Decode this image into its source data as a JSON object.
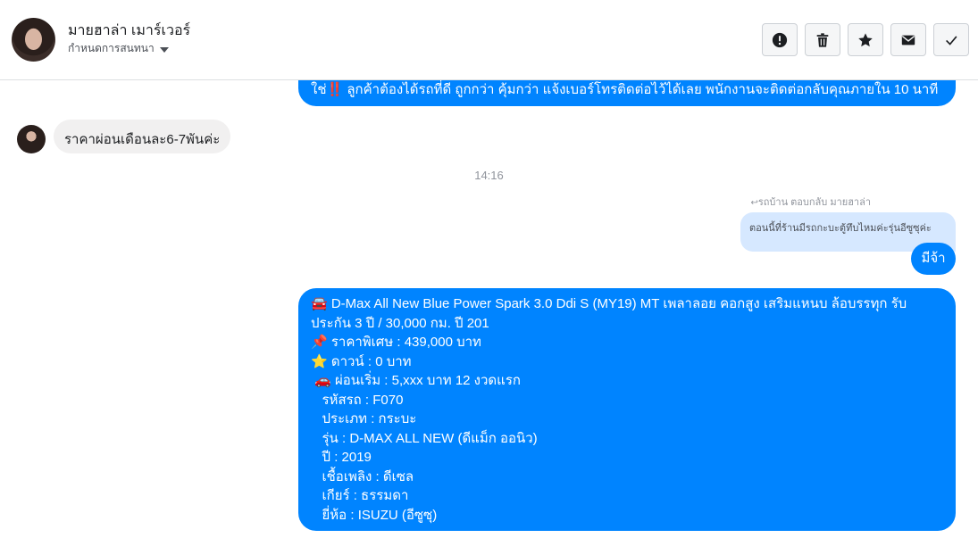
{
  "header": {
    "contact_name": "มายฮาล่า เมาร์เวอร์",
    "assign_label": "กำหนดการสนทนา",
    "actions": [
      {
        "name": "report-button",
        "icon": "exclamation-circle-icon"
      },
      {
        "name": "delete-button",
        "icon": "trash-icon"
      },
      {
        "name": "star-button",
        "icon": "star-icon"
      },
      {
        "name": "mark-unread-button",
        "icon": "envelope-icon"
      },
      {
        "name": "mark-done-button",
        "icon": "check-icon"
      }
    ]
  },
  "messages": {
    "top_out_text": "ใช่‼️ ลูกค้าต้องได้รถที่ดี ถูกกว่า คุ้มกว่า แจ้งเบอร์โทรติดต่อไว้ได้เลย พนักงานจะติดต่อกลับคุณภายใน 10 นาที",
    "incoming_text": "ราคาผ่อนเดือนละ6-7พันค่ะ",
    "timestamp": "14:16",
    "reply_meta": "รถบ้าน ตอบกลับ มายฮาล่า",
    "quoted_text": "ตอนนี้ที่ร้านมีรถกะบะตู้ทึบไหมค่ะรุ่นอีซูซุค่ะ",
    "short_reply": "มีจ้า",
    "listing_lines": [
      "🚘 D-Max All New Blue Power Spark 3.0 Ddi S (MY19) MT เพลาลอย คอกสูง เสริมแหนบ ล้อบรรทุก รับ",
      "ประกัน 3 ปี / 30,000 กม. ปี 201",
      "📌 ราคาพิเศษ : 439,000 บาท",
      "⭐ ดาวน์ : 0 บาท",
      " 🚗 ผ่อนเริ่ม : 5,xxx บาท 12 งวดแรก",
      "   รหัสรถ : F070",
      "   ประเภท : กระบะ",
      "   รุ่น : D-MAX ALL NEW (ดีแม็ก ออนิว)",
      "   ปี : 2019",
      "   เชื้อเพลิง : ดีเซล",
      "   เกียร์ : ธรรมดา",
      "   ยี่ห้อ : ISUZU (อีซูซุ)"
    ]
  },
  "colors": {
    "outgoing_bubble": "#0084ff",
    "incoming_bubble": "#f1f0f0",
    "quoted_bubble": "#d6e8ff"
  }
}
